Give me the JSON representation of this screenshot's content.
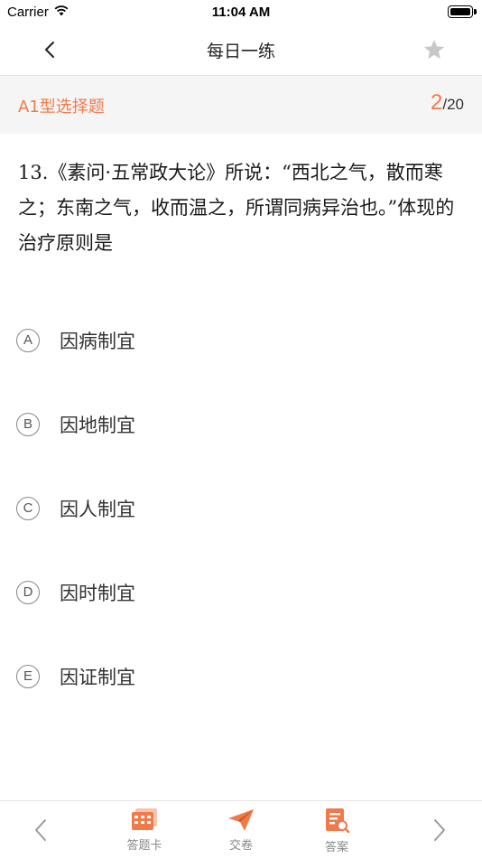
{
  "status_bar": {
    "carrier": "Carrier",
    "time": "11:04 AM"
  },
  "nav": {
    "title": "每日一练",
    "back_icon": "chevron-left-icon",
    "favorite_icon": "star-icon"
  },
  "question_meta": {
    "type_label": "A1型选择题",
    "current": "2",
    "separator": "/",
    "total": "20"
  },
  "question": {
    "text": "13.《素问·五常政大论》所说：“西北之气，散而寒之；东南之气，收而温之，所谓同病异治也。”体现的治疗原则是"
  },
  "options": [
    {
      "letter": "A",
      "text": "因病制宜"
    },
    {
      "letter": "B",
      "text": "因地制宜"
    },
    {
      "letter": "C",
      "text": "因人制宜"
    },
    {
      "letter": "D",
      "text": "因时制宜"
    },
    {
      "letter": "E",
      "text": "因证制宜"
    }
  ],
  "tab_bar": {
    "answer_card_label": "答题卡",
    "submit_label": "交卷",
    "answer_label": "答案"
  },
  "colors": {
    "accent": "#f07a4a",
    "icon_gray": "#c8c8c8"
  }
}
